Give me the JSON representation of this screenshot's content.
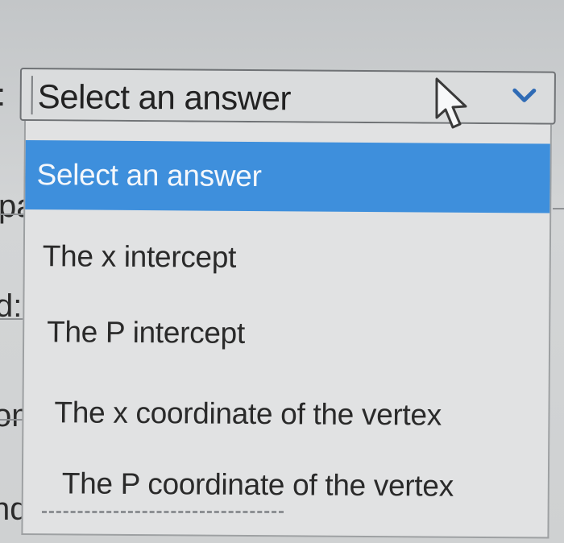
{
  "background_fragments": [
    ":",
    "pa",
    "d:",
    "om",
    "nd:"
  ],
  "select": {
    "value": "Select an answer"
  },
  "dropdown": {
    "options": [
      {
        "label": "Select an answer",
        "selected": true
      },
      {
        "label": "The x intercept",
        "selected": false
      },
      {
        "label": "The P intercept",
        "selected": false
      },
      {
        "label": "The x coordinate of the vertex",
        "selected": false
      },
      {
        "label": "The P coordinate of the vertex",
        "selected": false
      }
    ]
  },
  "colors": {
    "highlight": "#3e8fdc",
    "panel": "#e1e2e3",
    "border": "#6f7275"
  },
  "icons": {
    "chevron": "chevron-down-icon",
    "cursor": "mouse-pointer-icon"
  }
}
